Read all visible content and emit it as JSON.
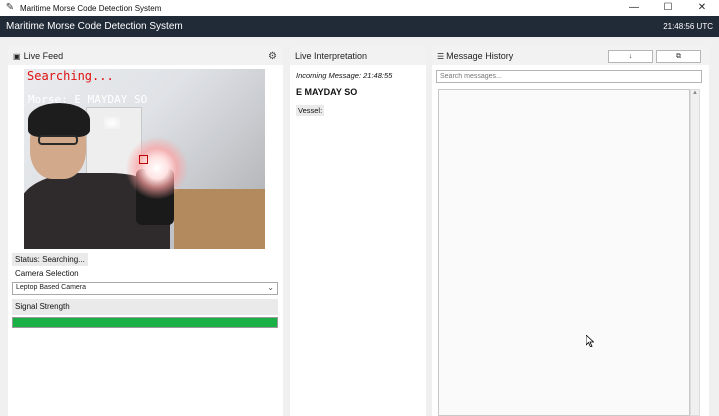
{
  "window": {
    "title": "Maritime Morse Code Detection System",
    "buttons": {
      "minimize": "—",
      "maximize": "☐",
      "close": "✕"
    }
  },
  "header": {
    "title": "Maritime Morse Code Detection System",
    "time": "21:48:56 UTC"
  },
  "live_feed": {
    "icon": "camera-icon",
    "title": "Live Feed",
    "settings_icon": "gear-icon",
    "overlay_status": "Searching...",
    "overlay_morse": "Morse: E MAYDAY SO",
    "status_label": "Status: Searching...",
    "camera_selection_label": "Camera Selection",
    "camera_selected": "Leptop Based Camera",
    "signal_strength_label": "Signal Strength",
    "signal_strength": 1.0,
    "signal_color": "#1bb045"
  },
  "interpretation": {
    "title": "Live Interpretation",
    "incoming": "Incoming Message: 21:48:55",
    "message": "E MAYDAY SO",
    "vessel_label": "Vessel:"
  },
  "history": {
    "icon": "menu-icon",
    "title": "Message History",
    "download_label": "↓",
    "copy_label": "⧉",
    "search_placeholder": "Search messages..."
  },
  "colors": {
    "header_bg": "#212a37",
    "overlay_red": "#e01010"
  }
}
